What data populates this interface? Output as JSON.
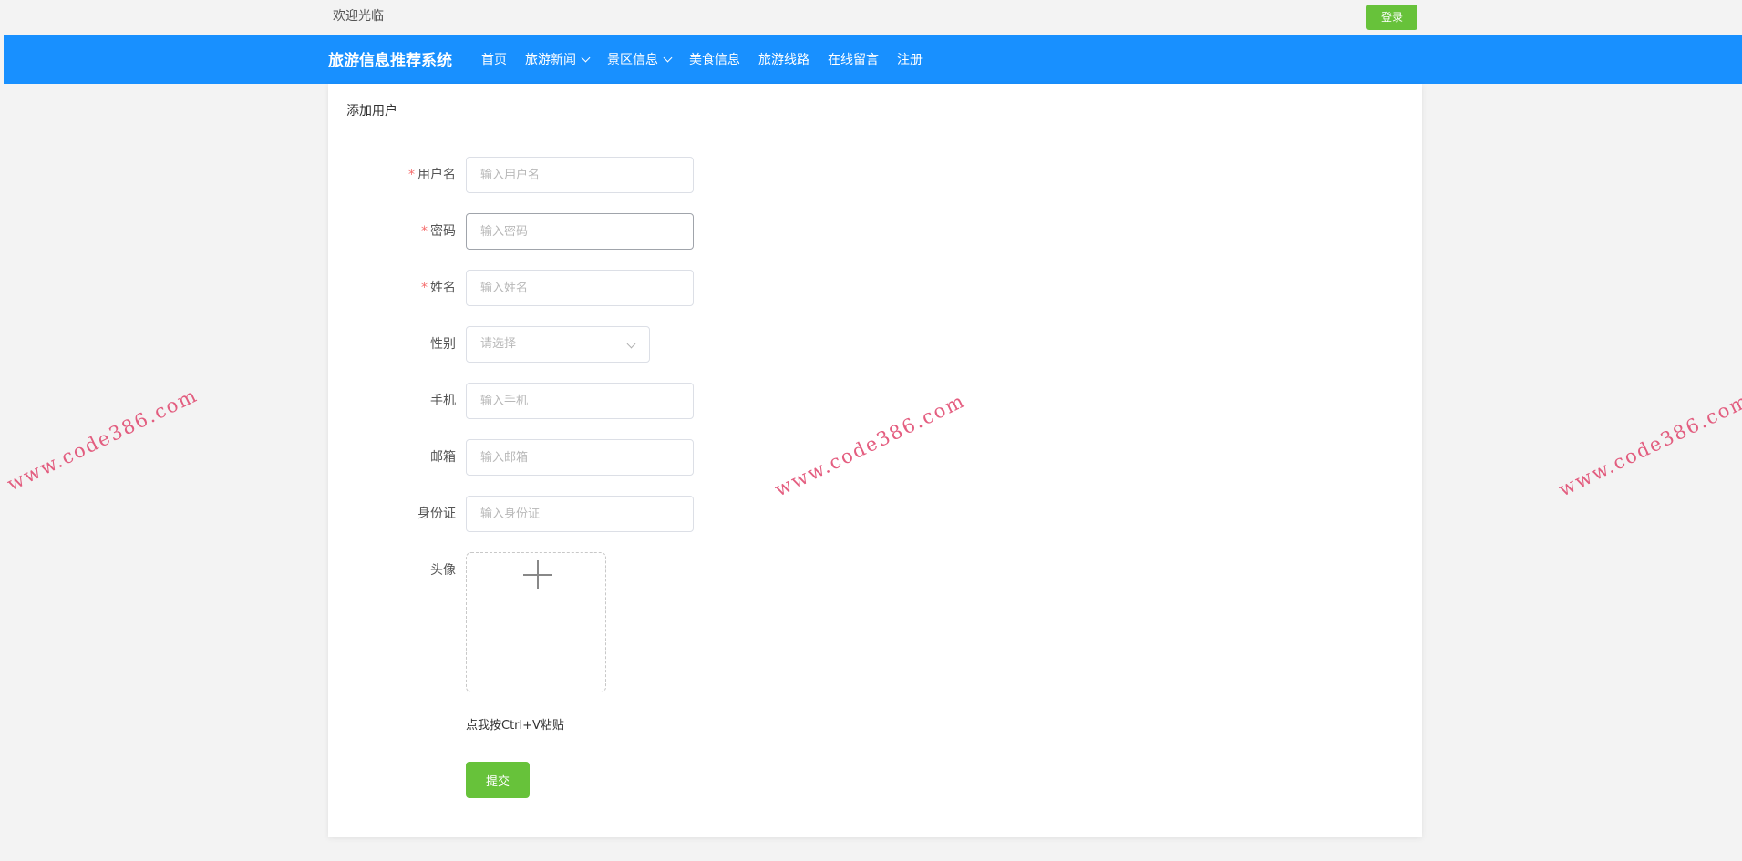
{
  "topbar": {
    "welcome_text": "欢迎光临",
    "login_label": "登录"
  },
  "navbar": {
    "brand": "旅游信息推荐系统",
    "items": [
      {
        "label": "首页",
        "has_dropdown": false
      },
      {
        "label": "旅游新闻",
        "has_dropdown": true
      },
      {
        "label": "景区信息",
        "has_dropdown": true
      },
      {
        "label": "美食信息",
        "has_dropdown": false
      },
      {
        "label": "旅游线路",
        "has_dropdown": false
      },
      {
        "label": "在线留言",
        "has_dropdown": false
      },
      {
        "label": "注册",
        "has_dropdown": false
      }
    ]
  },
  "form": {
    "title": "添加用户",
    "username": {
      "label": "用户名",
      "required": true,
      "placeholder": "输入用户名",
      "value": ""
    },
    "password": {
      "label": "密码",
      "required": true,
      "placeholder": "输入密码",
      "value": ""
    },
    "name": {
      "label": "姓名",
      "required": true,
      "placeholder": "输入姓名",
      "value": ""
    },
    "gender": {
      "label": "性别",
      "placeholder": "请选择",
      "value": ""
    },
    "phone": {
      "label": "手机",
      "placeholder": "输入手机",
      "value": ""
    },
    "email": {
      "label": "邮箱",
      "placeholder": "输入邮箱",
      "value": ""
    },
    "idcard": {
      "label": "身份证",
      "placeholder": "输入身份证",
      "value": ""
    },
    "avatar": {
      "label": "头像",
      "paste_hint": "点我按Ctrl+V粘贴"
    },
    "submit_label": "提交"
  },
  "watermark": {
    "text": "www.code386.com"
  },
  "colors": {
    "nav_bg": "#1890ff",
    "success": "#67c23a",
    "required": "#f56c6c",
    "watermark": "#e0436b"
  }
}
